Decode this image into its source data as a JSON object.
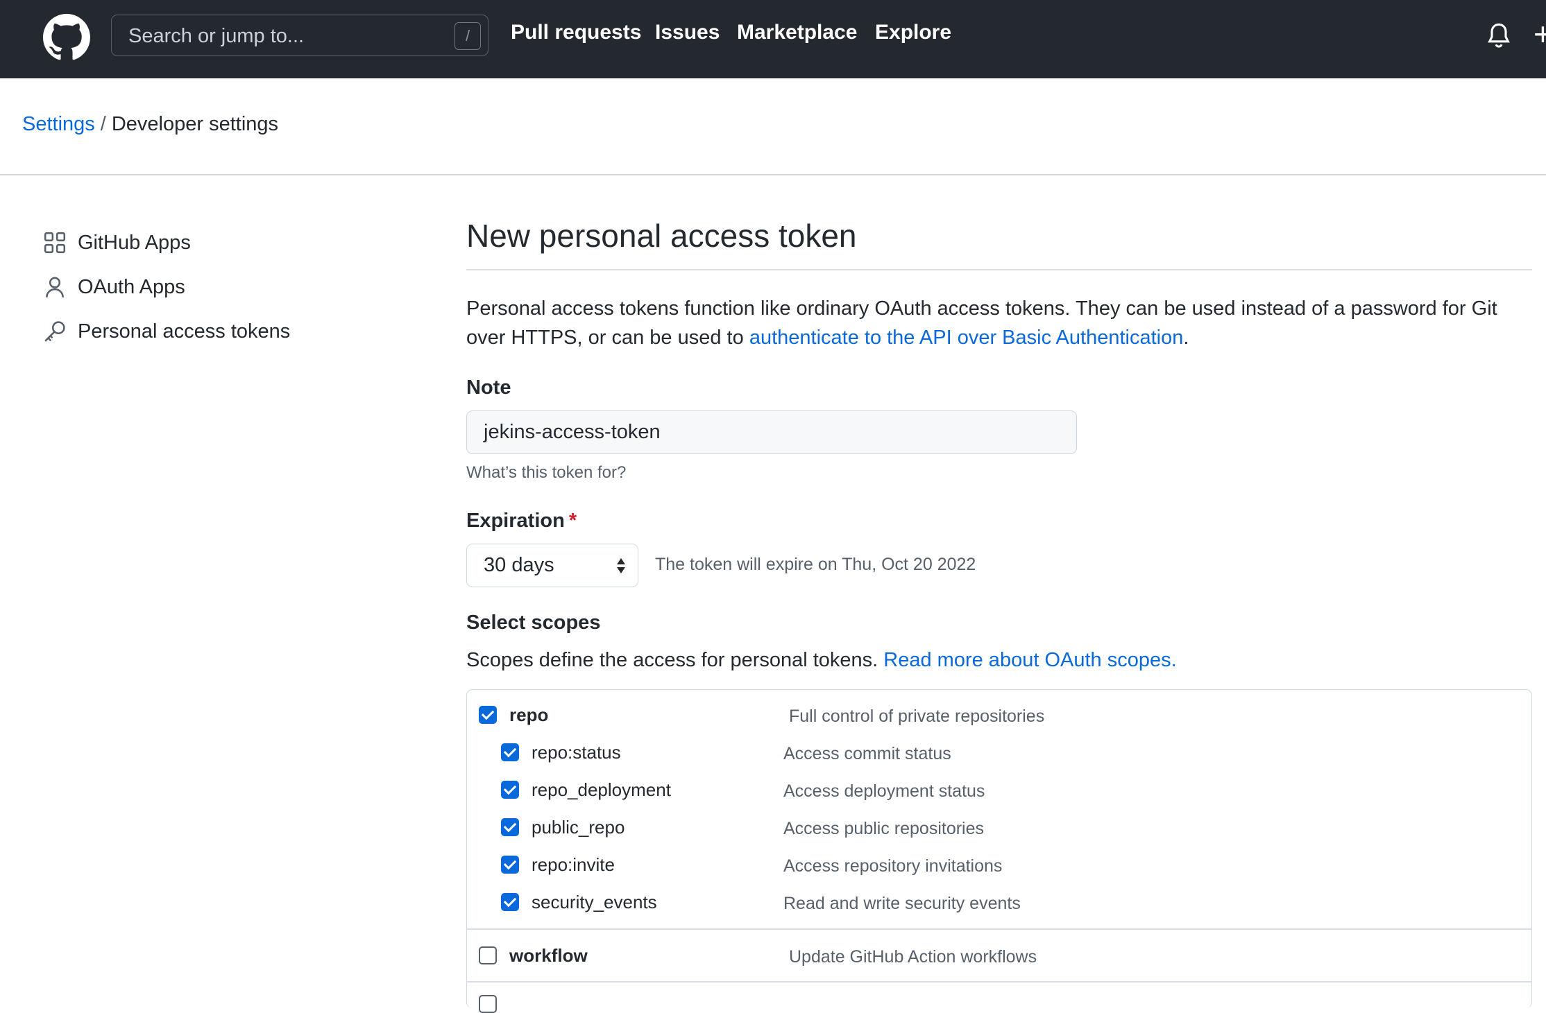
{
  "header": {
    "search_placeholder": "Search or jump to...",
    "search_shortcut": "/",
    "nav": [
      "Pull requests",
      "Issues",
      "Marketplace",
      "Explore"
    ],
    "plus": "+"
  },
  "breadcrumb": {
    "parent": "Settings",
    "separator": "/",
    "current": "Developer settings"
  },
  "sidebar": {
    "items": [
      {
        "label": "GitHub Apps",
        "icon": "apps-icon"
      },
      {
        "label": "OAuth Apps",
        "icon": "person-icon"
      },
      {
        "label": "Personal access tokens",
        "icon": "key-icon"
      }
    ]
  },
  "main": {
    "title": "New personal access token",
    "intro_text": "Personal access tokens function like ordinary OAuth access tokens. They can be used instead of a password for Git over HTTPS, or can be used to ",
    "intro_link": "authenticate to the API over Basic Authentication",
    "intro_end": ".",
    "note_label": "Note",
    "note_value": "jekins-access-token",
    "note_hint": "What’s this token for?",
    "expiration_label": "Expiration",
    "expiration_required": "*",
    "expiration_value": "30 days",
    "expiration_note": "The token will expire on Thu, Oct 20 2022",
    "scopes_label": "Select scopes",
    "scopes_text": "Scopes define the access for personal tokens. ",
    "scopes_link": "Read more about OAuth scopes."
  },
  "scopes": [
    {
      "name": "repo",
      "description": "Full control of private repositories",
      "checked": true,
      "parent": true
    },
    {
      "name": "repo:status",
      "description": "Access commit status",
      "checked": true,
      "parent": false
    },
    {
      "name": "repo_deployment",
      "description": "Access deployment status",
      "checked": true,
      "parent": false
    },
    {
      "name": "public_repo",
      "description": "Access public repositories",
      "checked": true,
      "parent": false
    },
    {
      "name": "repo:invite",
      "description": "Access repository invitations",
      "checked": true,
      "parent": false
    },
    {
      "name": "security_events",
      "description": "Read and write security events",
      "checked": true,
      "parent": false
    },
    {
      "name": "workflow",
      "description": "Update GitHub Action workflows",
      "checked": false,
      "parent": true
    }
  ],
  "colors": {
    "link": "#0969da",
    "header_bg": "#24292f",
    "checkbox": "#0969da"
  }
}
